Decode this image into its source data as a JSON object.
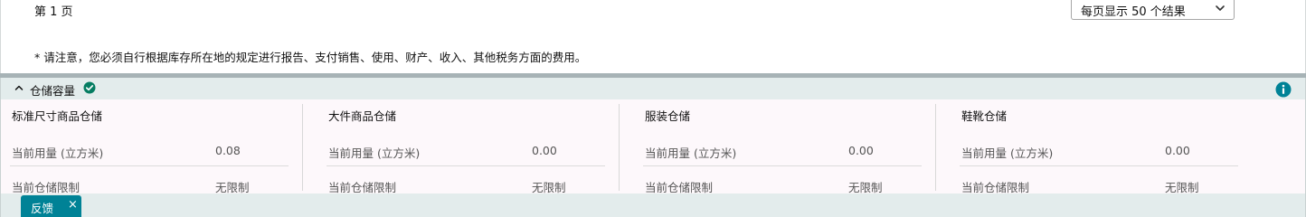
{
  "pagination": {
    "page_label": "第 1 页",
    "per_page_selected": "每页显示 50 个结果"
  },
  "notice": "* 请注意，您必须自行根据库存所在地的规定进行报告、支付销售、使用、财产、收入、其他税务方面的费用。",
  "storage": {
    "title": "仓储容量",
    "status_icon": "check-circle-icon",
    "status_color": "#067d62",
    "info_icon": "info-icon",
    "accent_color": "#008296",
    "columns": [
      {
        "title": "标准尺寸商品仓储",
        "usage_label": "当前用量 (立方米)",
        "usage_value": "0.08",
        "limit_label": "当前仓储限制",
        "limit_value": "无限制"
      },
      {
        "title": "大件商品仓储",
        "usage_label": "当前用量 (立方米)",
        "usage_value": "0.00",
        "limit_label": "当前仓储限制",
        "limit_value": "无限制"
      },
      {
        "title": "服装仓储",
        "usage_label": "当前用量 (立方米)",
        "usage_value": "0.00",
        "limit_label": "当前仓储限制",
        "limit_value": "无限制"
      },
      {
        "title": "鞋靴仓储",
        "usage_label": "当前用量 (立方米)",
        "usage_value": "0.00",
        "limit_label": "当前仓储限制",
        "limit_value": "无限制"
      }
    ]
  },
  "feedback": {
    "label": "反馈",
    "close": "×"
  }
}
